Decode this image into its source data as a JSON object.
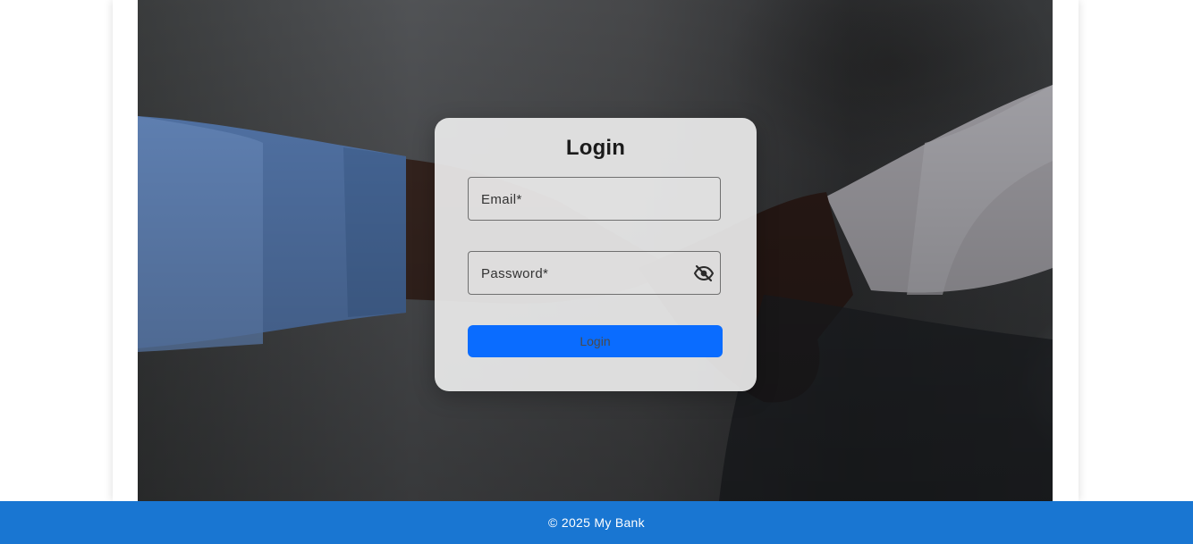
{
  "login": {
    "title": "Login",
    "email_label": "Email*",
    "password_label": "Password*",
    "submit_label": "Login",
    "password_toggle_icon": "eye-off-icon"
  },
  "footer": {
    "text": "© 2025 My Bank"
  },
  "colors": {
    "primary_button": "#0a6cff",
    "footer_bar": "#1976d2",
    "card_background": "#ececec"
  }
}
